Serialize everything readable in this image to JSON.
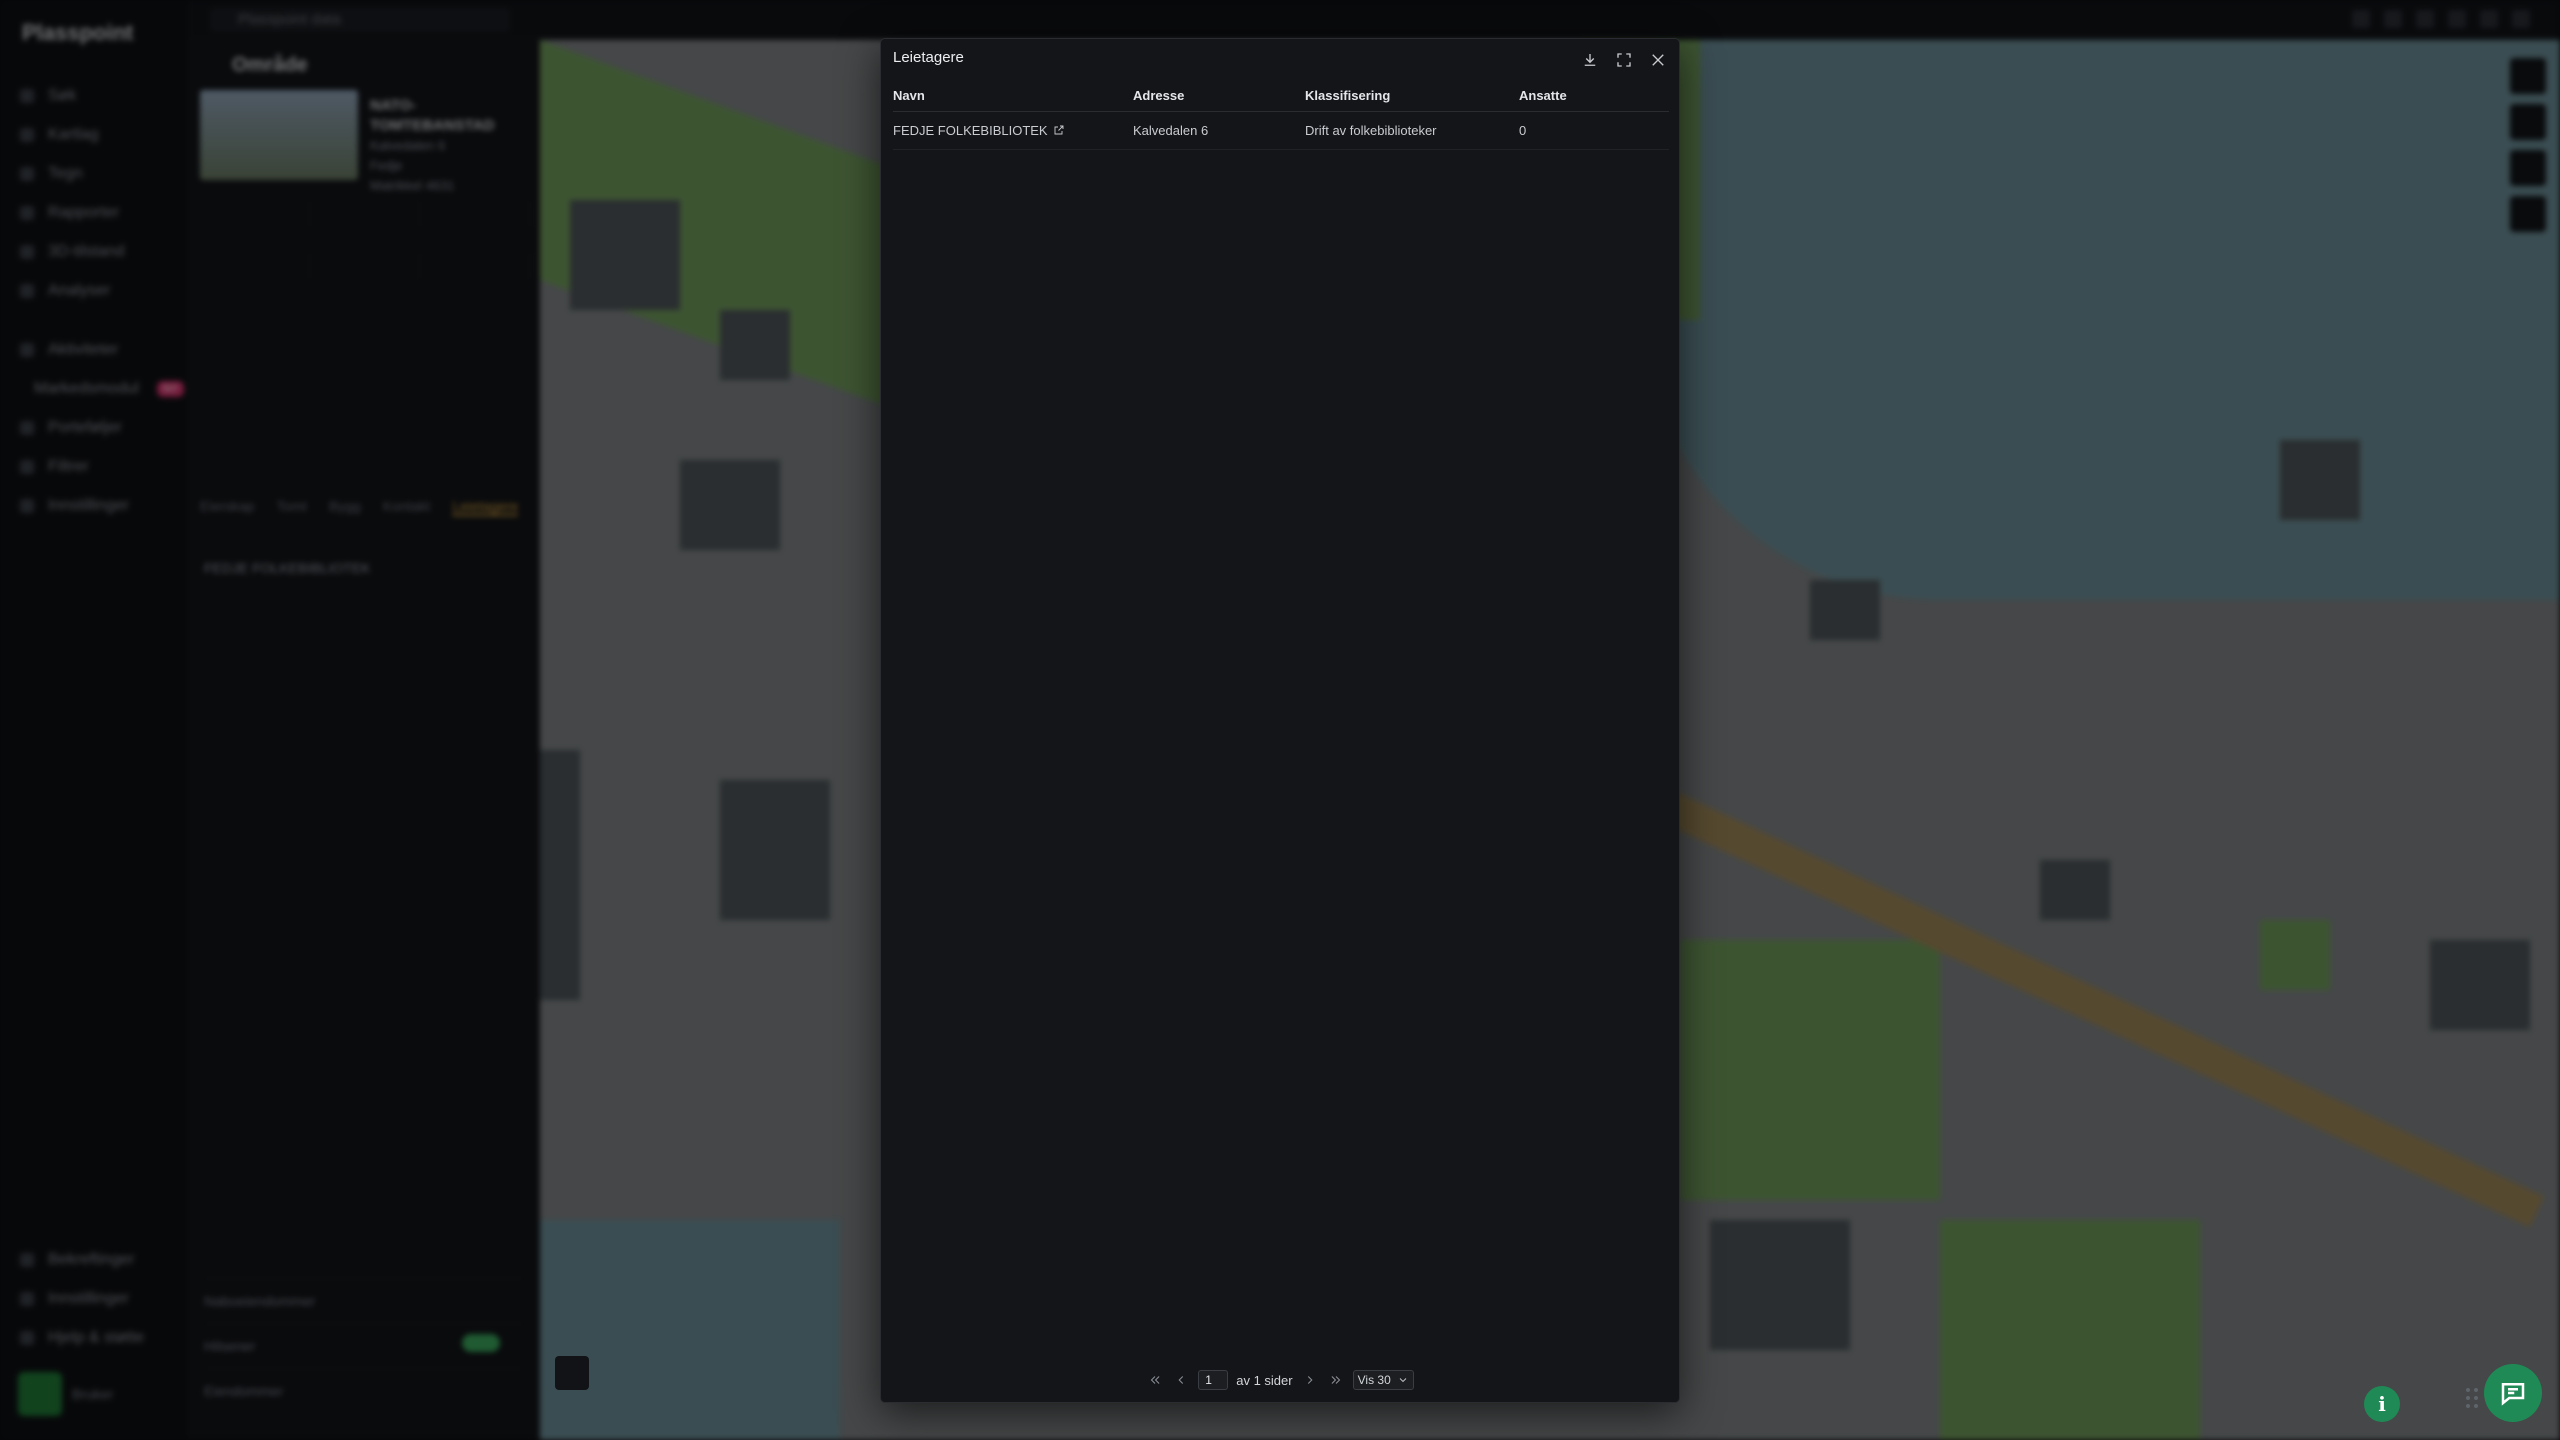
{
  "app": {
    "brand": "Plasspoint",
    "tab_label": "Plasspoint data",
    "nav_items": [
      "Søk",
      "Kartlag",
      "Tegn",
      "Rapporter",
      "3D-tilstand",
      "Analyser"
    ],
    "nav_items_2": [
      "Aktiviteter",
      "Markedsmodul",
      "Porteføljer",
      "Filtrer",
      "Innstillinger"
    ],
    "nav_badge": "NY",
    "nav_bottom": [
      "Bekreftinger",
      "Innstillinger",
      "Hjelp & støtte"
    ],
    "user_name": "Bruker"
  },
  "panel": {
    "title": "Område",
    "meta_title": "NATO-TOMTEBANSTAD",
    "meta_lines": [
      "Kalvedalen 6",
      "Fedje",
      "Matrikkel 4631"
    ],
    "tabs": [
      "Eierskap",
      "Tomt",
      "Bygg",
      "Kontakt",
      "Leietagere"
    ],
    "row_text": "FEDJE FOLKEBIBLIOTEK",
    "foot_items": [
      "Naboeiendommer",
      "Hilsener",
      "Eiendommer"
    ]
  },
  "modal": {
    "title": "Leietagere",
    "columns": [
      "Navn",
      "Adresse",
      "Klassifisering",
      "Ansatte"
    ],
    "rows": [
      {
        "name": "FEDJE FOLKEBIBLIOTEK",
        "address": "Kalvedalen 6",
        "classification": "Drift av folkebiblioteker",
        "employees": "0"
      }
    ],
    "pager": {
      "page": "1",
      "total_label": "av 1 sider",
      "page_size_label": "Vis 30"
    }
  },
  "icons": {
    "download": "download-icon",
    "expand": "expand-icon",
    "close": "close-icon",
    "external": "external-link-icon",
    "info": "info-icon",
    "chat": "chat-icon"
  },
  "colors": {
    "accent_green": "#1f8a55",
    "modal_bg": "#141518"
  }
}
